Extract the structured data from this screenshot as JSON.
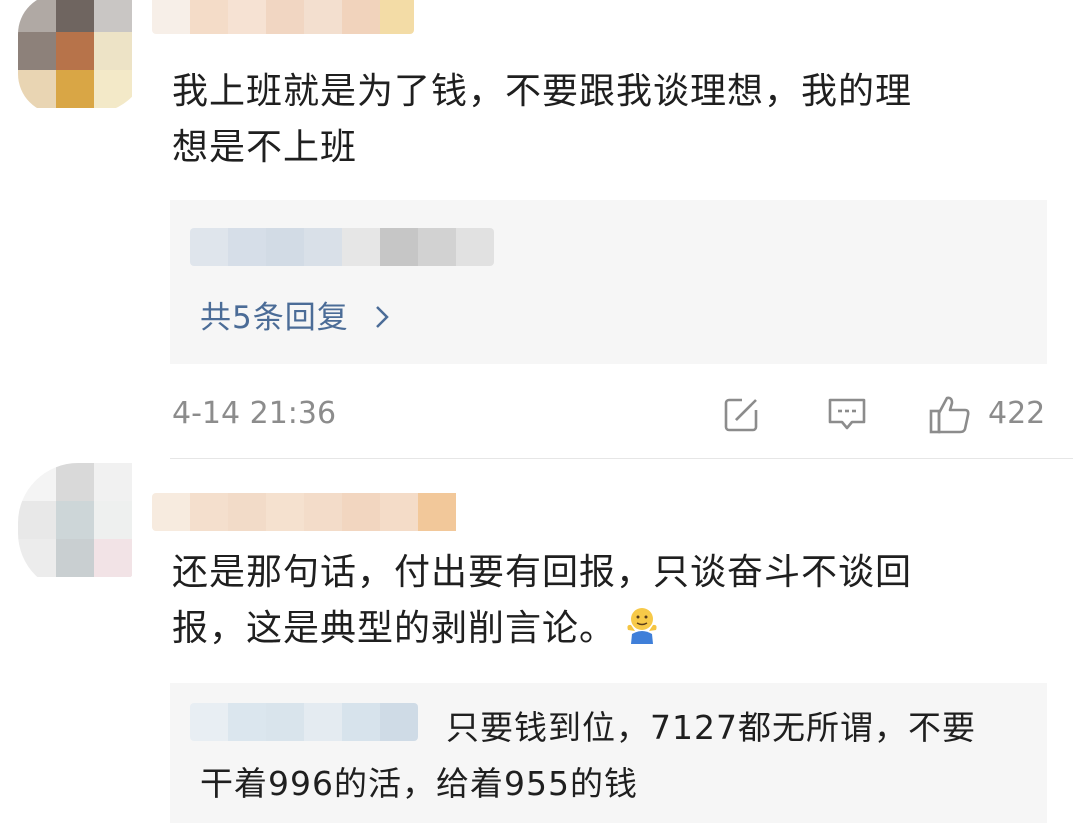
{
  "comments": [
    {
      "text": "我上班就是为了钱，不要跟我谈理想，我的理\n想是不上班",
      "replies_link": "共5条回复",
      "timestamp": "4-14 21:36",
      "likes": "422"
    },
    {
      "text": "还是那句话，付出要有回报，只谈奋斗不谈回\n报，这是典型的剥削言论。",
      "emoji": "shrug-emoji",
      "reply_text_line1": "只要钱到位，7127都无所谓，不要",
      "reply_text_line2": "干着996的活，给着955的钱"
    }
  ],
  "colors": {
    "link": "#4b6c97",
    "meta": "#8c8c8c",
    "reply_bg": "#f6f6f6"
  },
  "icons": [
    "chevron-right-icon",
    "share-icon",
    "comment-icon",
    "thumbs-up-icon"
  ]
}
